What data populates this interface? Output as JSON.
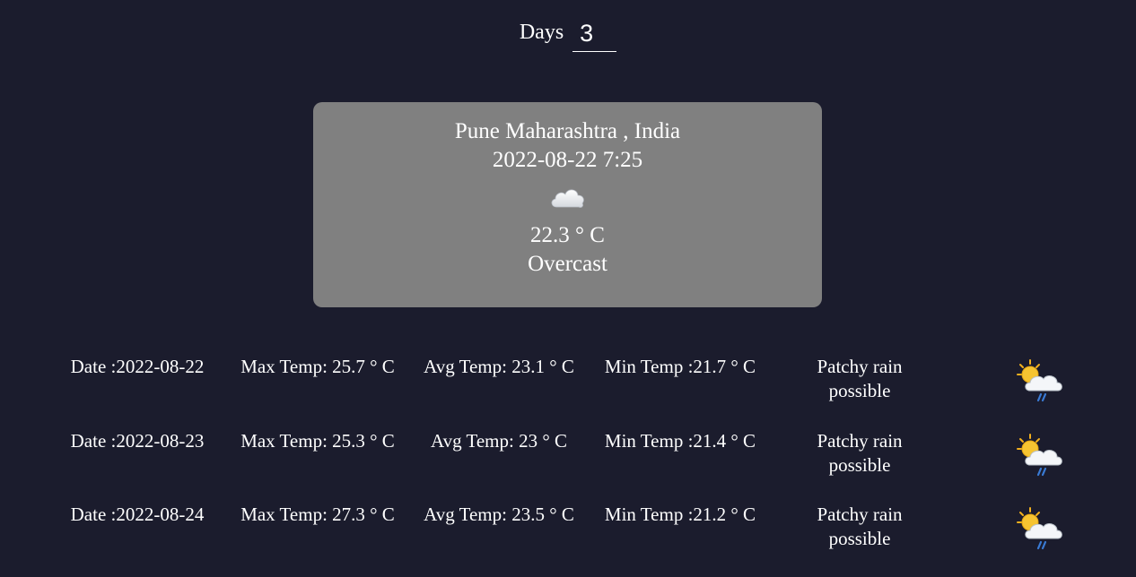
{
  "days": {
    "label": "Days",
    "value": "3"
  },
  "current": {
    "location": "Pune Maharashtra , India",
    "datetime": "2022-08-22 7:25",
    "icon": "cloud-icon",
    "temperature": "22.3 ° C",
    "condition": "Overcast"
  },
  "forecast": [
    {
      "date": "Date :2022-08-22",
      "max_temp": "Max Temp: 25.7 ° C",
      "avg_temp": "Avg Temp: 23.1 ° C",
      "min_temp": "Min Temp :21.7 ° C",
      "condition": "Patchy rain possible",
      "icon": "patchy-rain-icon"
    },
    {
      "date": "Date :2022-08-23",
      "max_temp": "Max Temp: 25.3 ° C",
      "avg_temp": "Avg Temp: 23 ° C",
      "min_temp": "Min Temp :21.4 ° C",
      "condition": "Patchy rain possible",
      "icon": "patchy-rain-icon"
    },
    {
      "date": "Date :2022-08-24",
      "max_temp": "Max Temp: 27.3 ° C",
      "avg_temp": "Avg Temp: 23.5 ° C",
      "min_temp": "Min Temp :21.2 ° C",
      "condition": "Patchy rain possible",
      "icon": "patchy-rain-icon"
    }
  ]
}
